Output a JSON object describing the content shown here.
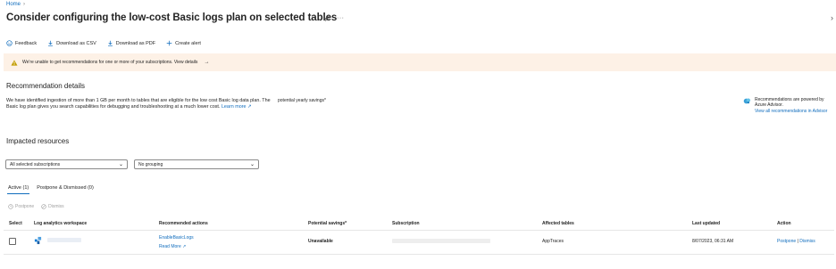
{
  "breadcrumb": {
    "home": "Home"
  },
  "header": {
    "title": "Consider configuring the low-cost Basic logs plan on selected tables",
    "pin_icon": "pin-icon",
    "more_icon": "ellipsis-icon"
  },
  "toolbar": {
    "feedback": "Feedback",
    "download_csv": "Download as CSV",
    "download_pdf": "Download as PDF",
    "create_alert": "Create alert"
  },
  "warning": {
    "text": "We're unable to get recommendations for one or more of your subscriptions. View details",
    "color": "#fdf1e6"
  },
  "recommendation": {
    "heading": "Recommendation details",
    "description": "We have identified ingestion of more than 1 GB per month to tables that are eligible for the low cost Basic log data plan. The Basic log plan gives you search capabilities for debugging and troubleshooting at a much lower cost.",
    "learn_more": "Learn more",
    "savings_label": "potential yearly savings*"
  },
  "advisor": {
    "text": "Recommendations are powered by Azure Advisor.",
    "link": "View all recommendations in Advisor"
  },
  "impacted": {
    "heading": "Impacted resources",
    "subscription_filter": "All selected subscriptions",
    "grouping_filter": "No grouping"
  },
  "tabs": {
    "active": "Active (1)",
    "postponed": "Postpone & Dismissed (0)"
  },
  "row_actions": {
    "postpone": "Postpone",
    "dismiss": "Dismiss"
  },
  "table": {
    "headers": [
      "Select",
      "Log analytics workspace",
      "Recommended actions",
      "Potential savings*",
      "Subscription",
      "Affected tables",
      "Last updated",
      "Action"
    ],
    "rows": [
      {
        "action_primary": "EnableBasicLogs",
        "action_secondary": "Read More",
        "savings": "Unavailable",
        "affected_tables": "AppTraces",
        "last_updated": "8/07/2023, 06:31 AM",
        "postpone": "Postpone",
        "separator": "|",
        "dismiss": "Dismiss"
      }
    ]
  },
  "colors": {
    "accent": "#0f6cbd",
    "warning_icon": "#c19c00"
  }
}
